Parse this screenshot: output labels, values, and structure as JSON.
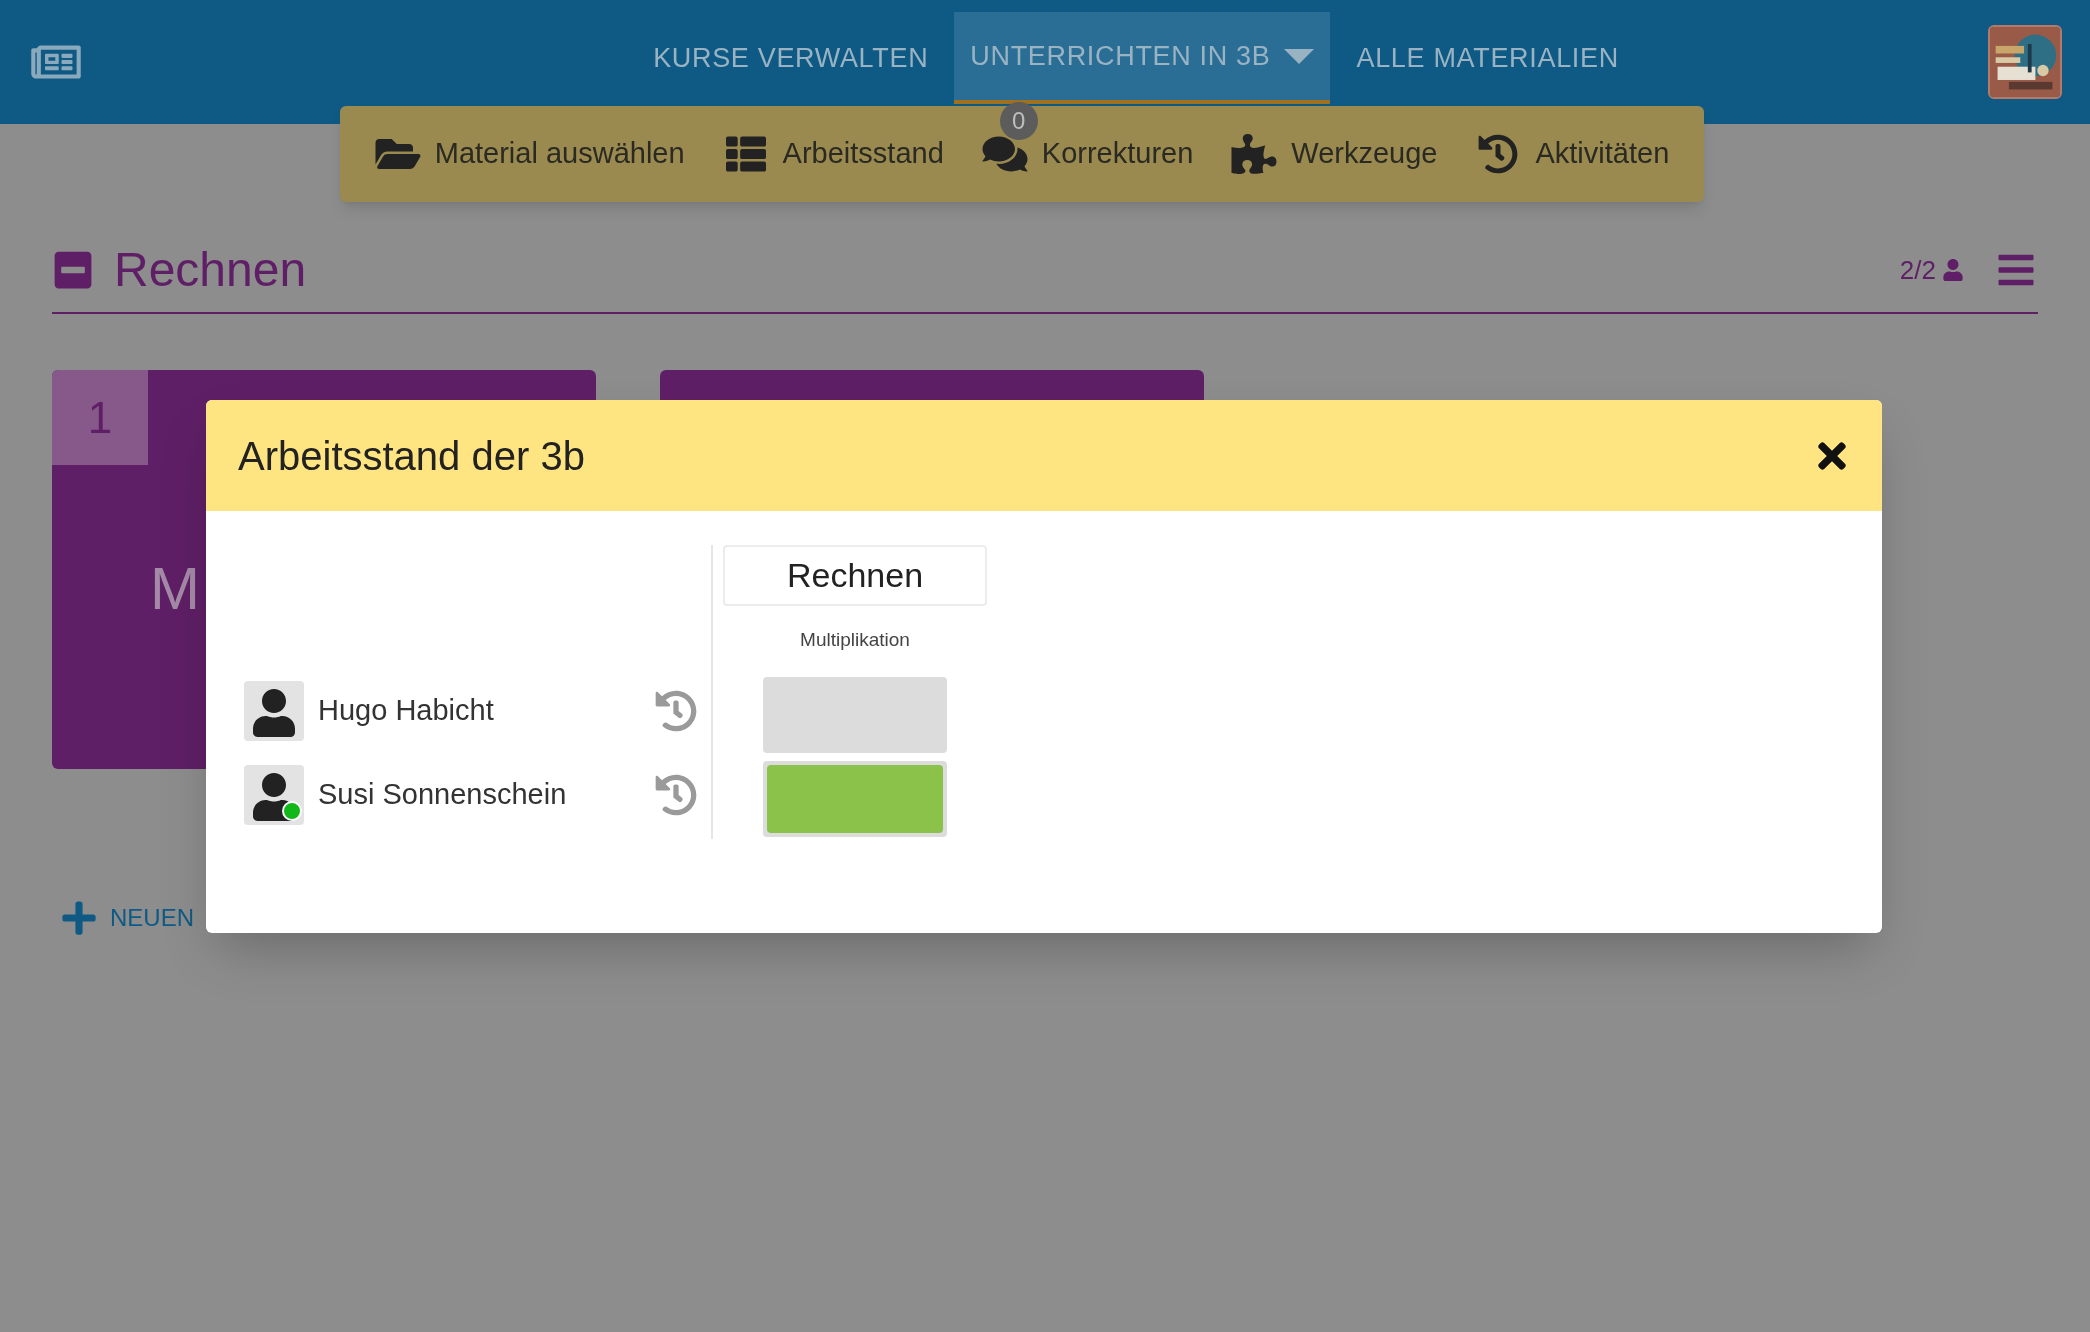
{
  "nav": {
    "items": [
      {
        "label": "KURSE VERWALTEN",
        "selected": false,
        "dropdown": false
      },
      {
        "label": "UNTERRICHTEN IN 3B",
        "selected": true,
        "dropdown": true
      },
      {
        "label": "ALLE MATERIALIEN",
        "selected": false,
        "dropdown": false
      }
    ]
  },
  "toolbar": {
    "items": [
      {
        "kind": "folder",
        "label": "Material auswählen"
      },
      {
        "kind": "list",
        "label": "Arbeitsstand"
      },
      {
        "kind": "comments",
        "label": "Korrekturen",
        "badge": "0"
      },
      {
        "kind": "puzzle",
        "label": "Werkzeuge"
      },
      {
        "kind": "history",
        "label": "Aktivitäten"
      }
    ]
  },
  "section": {
    "title": "Rechnen",
    "expanded": true,
    "members": "2/2"
  },
  "cards": [
    {
      "kind": "numbered",
      "number": "1",
      "title": "M"
    },
    {
      "kind": "plain"
    }
  ],
  "add_link": {
    "label": "NEUEN"
  },
  "dialog": {
    "title": "Arbeitsstand der 3b",
    "columns": [
      {
        "title": "Rechnen",
        "subtitle": "Multiplikation"
      }
    ],
    "students": [
      {
        "name": "Hugo Habicht",
        "online": false,
        "cells": [
          {
            "done": false
          }
        ]
      },
      {
        "name": "Susi Sonnenschein",
        "online": true,
        "cells": [
          {
            "done": true
          }
        ]
      }
    ]
  }
}
